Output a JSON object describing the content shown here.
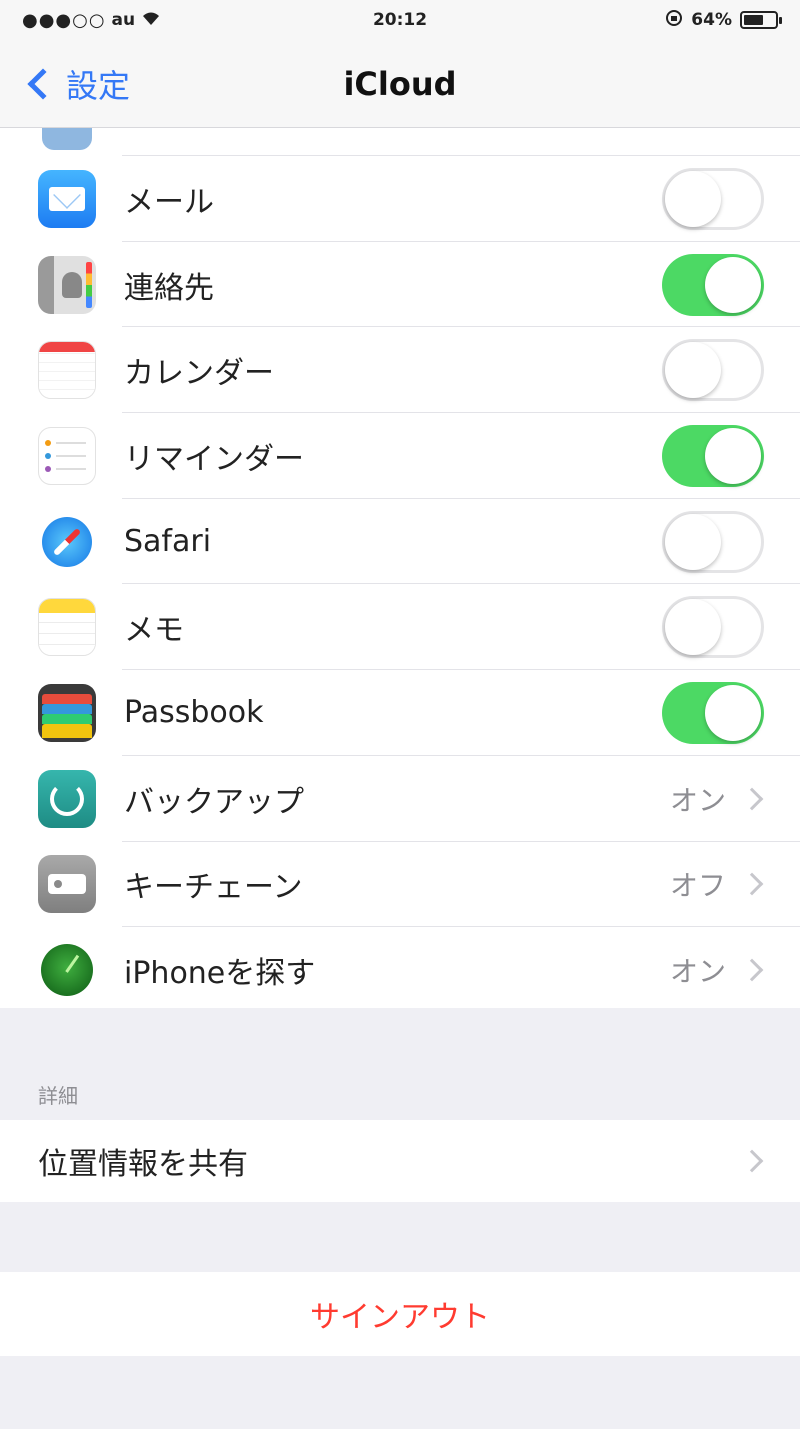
{
  "status_bar": {
    "carrier": "au",
    "time": "20:12",
    "battery_percent_text": "64%",
    "battery_level": 0.64
  },
  "nav": {
    "back_label": "設定",
    "title": "iCloud"
  },
  "items": [
    {
      "label": "メール",
      "icon": "mail-icon",
      "type": "toggle",
      "on": false
    },
    {
      "label": "連絡先",
      "icon": "contacts-icon",
      "type": "toggle",
      "on": true
    },
    {
      "label": "カレンダー",
      "icon": "calendar-icon",
      "type": "toggle",
      "on": false
    },
    {
      "label": "リマインダー",
      "icon": "reminders-icon",
      "type": "toggle",
      "on": true
    },
    {
      "label": "Safari",
      "icon": "safari-icon",
      "type": "toggle",
      "on": false
    },
    {
      "label": "メモ",
      "icon": "notes-icon",
      "type": "toggle",
      "on": false
    },
    {
      "label": "Passbook",
      "icon": "passbook-icon",
      "type": "toggle",
      "on": true
    },
    {
      "label": "バックアップ",
      "icon": "backup-icon",
      "type": "disclosure",
      "value": "オン"
    },
    {
      "label": "キーチェーン",
      "icon": "keychain-icon",
      "type": "disclosure",
      "value": "オフ"
    },
    {
      "label": "iPhoneを探す",
      "icon": "find-iphone-icon",
      "type": "disclosure",
      "value": "オン"
    }
  ],
  "advanced": {
    "header": "詳細",
    "share_location_label": "位置情報を共有"
  },
  "signout": {
    "label": "サインアウト"
  },
  "colors": {
    "accent": "#3478f6",
    "toggle_on": "#4cd964",
    "destructive": "#ff3b30",
    "background": "#efeff4"
  }
}
